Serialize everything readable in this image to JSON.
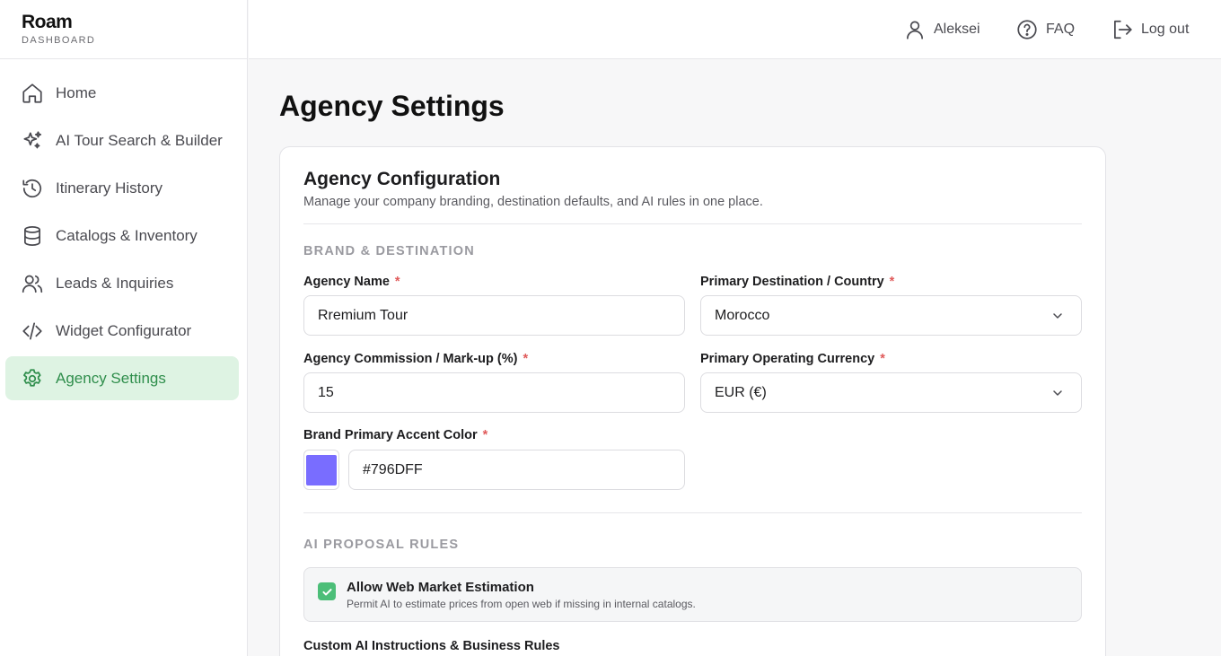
{
  "app": {
    "name": "Roam",
    "subtitle": "DASHBOARD"
  },
  "colors": {
    "accent_green": "#2f8e4c",
    "active_bg": "#def3e3",
    "brand_color": "#796DFF",
    "required": "#e05a5a"
  },
  "sidebar": {
    "items": [
      {
        "label": "Home",
        "icon": "home-icon"
      },
      {
        "label": "AI Tour Search & Builder",
        "icon": "sparkles-icon"
      },
      {
        "label": "Itinerary History",
        "icon": "history-icon"
      },
      {
        "label": "Catalogs & Inventory",
        "icon": "database-icon"
      },
      {
        "label": "Leads & Inquiries",
        "icon": "users-icon"
      },
      {
        "label": "Widget Configurator",
        "icon": "code-icon"
      },
      {
        "label": "Agency Settings",
        "icon": "gear-icon",
        "active": true
      }
    ]
  },
  "topbar": {
    "user": "Aleksei",
    "faq": "FAQ",
    "logout": "Log out"
  },
  "page": {
    "title": "Agency Settings"
  },
  "card": {
    "title": "Agency Configuration",
    "subtitle": "Manage your company branding, destination defaults, and AI rules in one place."
  },
  "brand_section": {
    "heading": "BRAND & DESTINATION",
    "agency_name": {
      "label": "Agency Name",
      "value": "Rremium Tour"
    },
    "destination": {
      "label": "Primary Destination / Country",
      "value": "Morocco"
    },
    "commission": {
      "label": "Agency Commission / Mark-up (%)",
      "value": "15"
    },
    "currency": {
      "label": "Primary Operating Currency",
      "value": "EUR (€)"
    },
    "accent_color": {
      "label": "Brand Primary Accent Color",
      "value": "#796DFF"
    },
    "required_mark": "*"
  },
  "ai_section": {
    "heading": "AI PROPOSAL RULES",
    "web_estimation": {
      "title": "Allow Web Market Estimation",
      "description": "Permit AI to estimate prices from open web if missing in internal catalogs.",
      "checked": true
    },
    "instructions_label": "Custom AI Instructions & Business Rules"
  }
}
